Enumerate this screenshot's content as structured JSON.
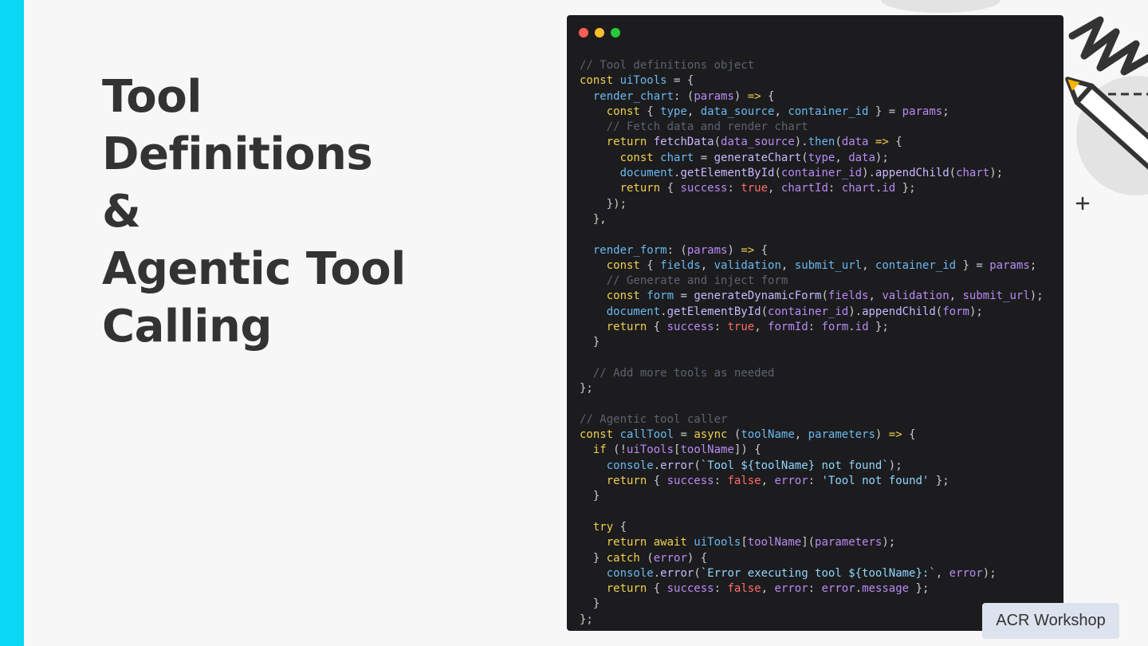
{
  "slide": {
    "title_lines": [
      "Tool",
      "Definitions",
      "&",
      "Agentic Tool",
      "Calling"
    ],
    "badge": "ACR Workshop",
    "accent_color": "#0ad8f5"
  },
  "code_window": {
    "controls": [
      "close-dot",
      "minimize-dot",
      "maximize-dot"
    ],
    "lines": [
      [
        [
          "c",
          "// Tool definitions object"
        ]
      ],
      [
        [
          "k",
          "const "
        ],
        [
          "v",
          "uiTools"
        ],
        [
          "a",
          " = {"
        ]
      ],
      [
        [
          "a",
          "  "
        ],
        [
          "v",
          "render_chart"
        ],
        [
          "a",
          ": ("
        ],
        [
          "s",
          "params"
        ],
        [
          "a",
          ") "
        ],
        [
          "k",
          "=>"
        ],
        [
          "a",
          " {"
        ]
      ],
      [
        [
          "a",
          "    "
        ],
        [
          "k",
          "const"
        ],
        [
          "a",
          " { "
        ],
        [
          "v",
          "type"
        ],
        [
          "a",
          ", "
        ],
        [
          "v",
          "data_source"
        ],
        [
          "a",
          ", "
        ],
        [
          "v",
          "container_id"
        ],
        [
          "a",
          " } = "
        ],
        [
          "s",
          "params"
        ],
        [
          "a",
          ";"
        ]
      ],
      [
        [
          "c",
          "    // Fetch data and render chart"
        ]
      ],
      [
        [
          "a",
          "    "
        ],
        [
          "k",
          "return "
        ],
        [
          "f",
          "fetchData"
        ],
        [
          "a",
          "("
        ],
        [
          "s",
          "data_source"
        ],
        [
          "a",
          ")."
        ],
        [
          "v",
          "then"
        ],
        [
          "a",
          "("
        ],
        [
          "s",
          "data"
        ],
        [
          "a",
          " "
        ],
        [
          "k",
          "=>"
        ],
        [
          "a",
          " {"
        ]
      ],
      [
        [
          "a",
          "      "
        ],
        [
          "k",
          "const "
        ],
        [
          "v",
          "chart"
        ],
        [
          "a",
          " = "
        ],
        [
          "f",
          "generateChart"
        ],
        [
          "a",
          "("
        ],
        [
          "s",
          "type"
        ],
        [
          "a",
          ", "
        ],
        [
          "s",
          "data"
        ],
        [
          "a",
          ");"
        ]
      ],
      [
        [
          "a",
          "      "
        ],
        [
          "v",
          "document"
        ],
        [
          "a",
          "."
        ],
        [
          "f",
          "getElementById"
        ],
        [
          "a",
          "("
        ],
        [
          "s",
          "container_id"
        ],
        [
          "a",
          ")."
        ],
        [
          "f",
          "appendChild"
        ],
        [
          "a",
          "("
        ],
        [
          "s",
          "chart"
        ],
        [
          "a",
          ");"
        ]
      ],
      [
        [
          "a",
          "      "
        ],
        [
          "k",
          "return"
        ],
        [
          "a",
          " { "
        ],
        [
          "s",
          "success"
        ],
        [
          "a",
          ": "
        ],
        [
          "b",
          "true"
        ],
        [
          "a",
          ", "
        ],
        [
          "s",
          "chartId"
        ],
        [
          "a",
          ": "
        ],
        [
          "s",
          "chart"
        ],
        [
          "a",
          "."
        ],
        [
          "s",
          "id"
        ],
        [
          "a",
          " };"
        ]
      ],
      [
        [
          "a",
          "    });"
        ]
      ],
      [
        [
          "a",
          "  },"
        ]
      ],
      [
        [
          "a",
          ""
        ]
      ],
      [
        [
          "a",
          "  "
        ],
        [
          "v",
          "render_form"
        ],
        [
          "a",
          ": ("
        ],
        [
          "s",
          "params"
        ],
        [
          "a",
          ") "
        ],
        [
          "k",
          "=>"
        ],
        [
          "a",
          " {"
        ]
      ],
      [
        [
          "a",
          "    "
        ],
        [
          "k",
          "const"
        ],
        [
          "a",
          " { "
        ],
        [
          "v",
          "fields"
        ],
        [
          "a",
          ", "
        ],
        [
          "v",
          "validation"
        ],
        [
          "a",
          ", "
        ],
        [
          "v",
          "submit_url"
        ],
        [
          "a",
          ", "
        ],
        [
          "v",
          "container_id"
        ],
        [
          "a",
          " } = "
        ],
        [
          "s",
          "params"
        ],
        [
          "a",
          ";"
        ]
      ],
      [
        [
          "c",
          "    // Generate and inject form"
        ]
      ],
      [
        [
          "a",
          "    "
        ],
        [
          "k",
          "const "
        ],
        [
          "v",
          "form"
        ],
        [
          "a",
          " = "
        ],
        [
          "f",
          "generateDynamicForm"
        ],
        [
          "a",
          "("
        ],
        [
          "s",
          "fields"
        ],
        [
          "a",
          ", "
        ],
        [
          "s",
          "validation"
        ],
        [
          "a",
          ", "
        ],
        [
          "s",
          "submit_url"
        ],
        [
          "a",
          ");"
        ]
      ],
      [
        [
          "a",
          "    "
        ],
        [
          "v",
          "document"
        ],
        [
          "a",
          "."
        ],
        [
          "f",
          "getElementById"
        ],
        [
          "a",
          "("
        ],
        [
          "s",
          "container_id"
        ],
        [
          "a",
          ")."
        ],
        [
          "f",
          "appendChild"
        ],
        [
          "a",
          "("
        ],
        [
          "s",
          "form"
        ],
        [
          "a",
          ");"
        ]
      ],
      [
        [
          "a",
          "    "
        ],
        [
          "k",
          "return"
        ],
        [
          "a",
          " { "
        ],
        [
          "s",
          "success"
        ],
        [
          "a",
          ": "
        ],
        [
          "b",
          "true"
        ],
        [
          "a",
          ", "
        ],
        [
          "s",
          "formId"
        ],
        [
          "a",
          ": "
        ],
        [
          "s",
          "form"
        ],
        [
          "a",
          "."
        ],
        [
          "s",
          "id"
        ],
        [
          "a",
          " };"
        ]
      ],
      [
        [
          "a",
          "  }"
        ]
      ],
      [
        [
          "a",
          ""
        ]
      ],
      [
        [
          "c",
          "  // Add more tools as needed"
        ]
      ],
      [
        [
          "a",
          "};"
        ]
      ],
      [
        [
          "a",
          ""
        ]
      ],
      [
        [
          "c",
          "// Agentic tool caller"
        ]
      ],
      [
        [
          "k",
          "const "
        ],
        [
          "v",
          "callTool"
        ],
        [
          "a",
          " = "
        ],
        [
          "k",
          "async"
        ],
        [
          "a",
          " ("
        ],
        [
          "v",
          "toolName"
        ],
        [
          "a",
          ", "
        ],
        [
          "v",
          "parameters"
        ],
        [
          "a",
          ") "
        ],
        [
          "k",
          "=>"
        ],
        [
          "a",
          " {"
        ]
      ],
      [
        [
          "a",
          "  "
        ],
        [
          "k",
          "if"
        ],
        [
          "a",
          " (!"
        ],
        [
          "s",
          "uiTools"
        ],
        [
          "a",
          "["
        ],
        [
          "s",
          "toolName"
        ],
        [
          "a",
          "]) {"
        ]
      ],
      [
        [
          "a",
          "    "
        ],
        [
          "v",
          "console"
        ],
        [
          "a",
          "."
        ],
        [
          "f",
          "error"
        ],
        [
          "a",
          "("
        ],
        [
          "st",
          "`Tool ${toolName} not found`"
        ],
        [
          "a",
          ");"
        ]
      ],
      [
        [
          "a",
          "    "
        ],
        [
          "k",
          "return"
        ],
        [
          "a",
          " { "
        ],
        [
          "s",
          "success"
        ],
        [
          "a",
          ": "
        ],
        [
          "b",
          "false"
        ],
        [
          "a",
          ", "
        ],
        [
          "s",
          "error"
        ],
        [
          "a",
          ": "
        ],
        [
          "st",
          "'Tool not found'"
        ],
        [
          "a",
          " };"
        ]
      ],
      [
        [
          "a",
          "  }"
        ]
      ],
      [
        [
          "a",
          ""
        ]
      ],
      [
        [
          "a",
          "  "
        ],
        [
          "k",
          "try"
        ],
        [
          "a",
          " {"
        ]
      ],
      [
        [
          "a",
          "    "
        ],
        [
          "k",
          "return await "
        ],
        [
          "v",
          "uiTools"
        ],
        [
          "a",
          "["
        ],
        [
          "s",
          "toolName"
        ],
        [
          "a",
          "]("
        ],
        [
          "s",
          "parameters"
        ],
        [
          "a",
          ");"
        ]
      ],
      [
        [
          "a",
          "  } "
        ],
        [
          "k",
          "catch"
        ],
        [
          "a",
          " ("
        ],
        [
          "s",
          "error"
        ],
        [
          "a",
          ") {"
        ]
      ],
      [
        [
          "a",
          "    "
        ],
        [
          "v",
          "console"
        ],
        [
          "a",
          "."
        ],
        [
          "f",
          "error"
        ],
        [
          "a",
          "("
        ],
        [
          "st",
          "`Error executing tool ${toolName}:`"
        ],
        [
          "a",
          ", "
        ],
        [
          "s",
          "error"
        ],
        [
          "a",
          ");"
        ]
      ],
      [
        [
          "a",
          "    "
        ],
        [
          "k",
          "return"
        ],
        [
          "a",
          " { "
        ],
        [
          "s",
          "success"
        ],
        [
          "a",
          ": "
        ],
        [
          "b",
          "false"
        ],
        [
          "a",
          ", "
        ],
        [
          "s",
          "error"
        ],
        [
          "a",
          ": "
        ],
        [
          "s",
          "error"
        ],
        [
          "a",
          "."
        ],
        [
          "s",
          "message"
        ],
        [
          "a",
          " };"
        ]
      ],
      [
        [
          "a",
          "  }"
        ]
      ],
      [
        [
          "a",
          "};"
        ]
      ]
    ]
  }
}
